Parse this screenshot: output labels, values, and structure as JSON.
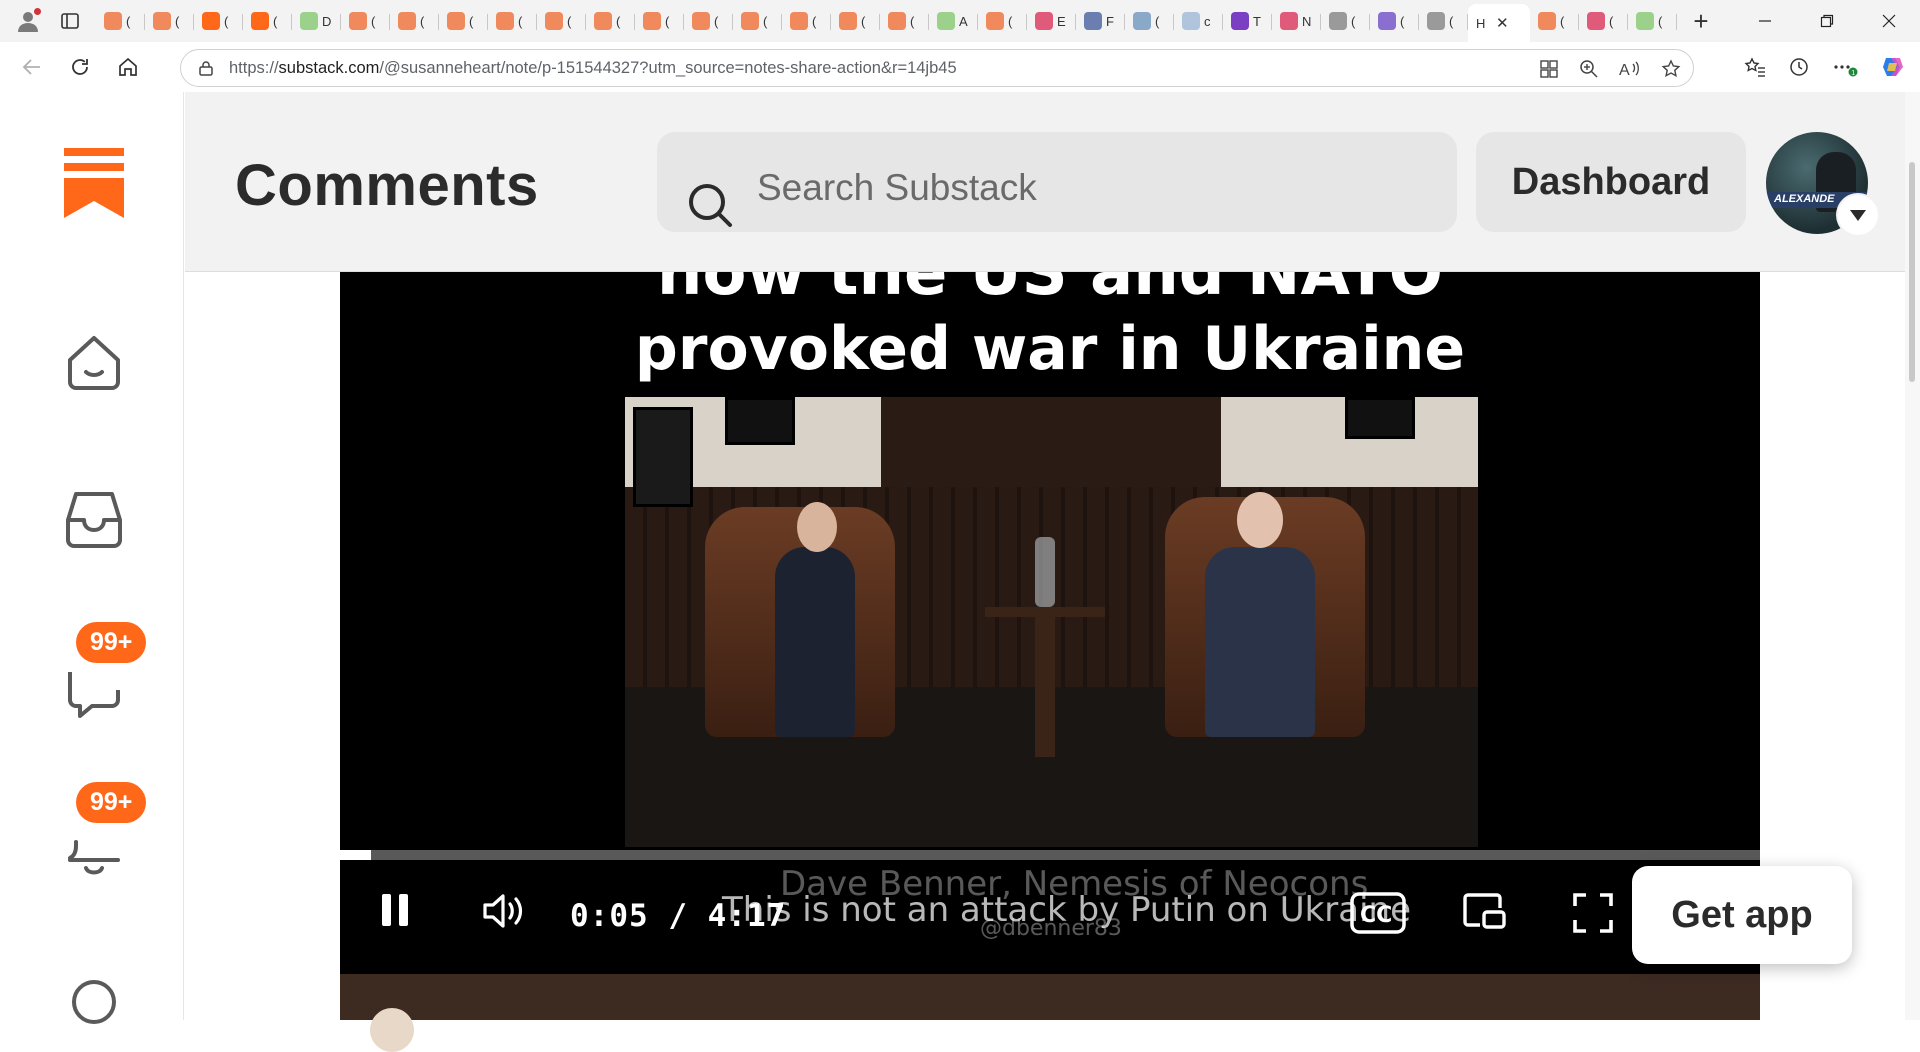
{
  "browser": {
    "tabs": [
      {
        "title": "(",
        "color": "#f08a5d"
      },
      {
        "title": "(",
        "color": "#f08a5d"
      },
      {
        "title": "(",
        "color": "#ff6719"
      },
      {
        "title": "(",
        "color": "#ff6719"
      },
      {
        "title": "D",
        "color": "#9bd18b"
      },
      {
        "title": "(",
        "color": "#f08a5d"
      },
      {
        "title": "(",
        "color": "#f08a5d"
      },
      {
        "title": "(",
        "color": "#f08a5d"
      },
      {
        "title": "(",
        "color": "#f08a5d"
      },
      {
        "title": "(",
        "color": "#f08a5d"
      },
      {
        "title": "(",
        "color": "#f08a5d"
      },
      {
        "title": "(",
        "color": "#f08a5d"
      },
      {
        "title": "(",
        "color": "#f08a5d"
      },
      {
        "title": "(",
        "color": "#f08a5d"
      },
      {
        "title": "(",
        "color": "#f08a5d"
      },
      {
        "title": "(",
        "color": "#f08a5d"
      },
      {
        "title": "(",
        "color": "#f08a5d"
      },
      {
        "title": "A",
        "color": "#9bd18b"
      },
      {
        "title": "(",
        "color": "#f08a5d"
      },
      {
        "title": "E",
        "color": "#e05a7a"
      },
      {
        "title": "F",
        "color": "#6a7fb0"
      },
      {
        "title": "(",
        "color": "#8aa8c8"
      },
      {
        "title": "c",
        "color": "#b0c4de"
      },
      {
        "title": "T",
        "color": "#7b3fc4"
      },
      {
        "title": "N",
        "color": "#e05a7a"
      },
      {
        "title": "(",
        "color": "#9a9a9a"
      },
      {
        "title": "(",
        "color": "#8a6fd0"
      },
      {
        "title": "(",
        "color": "#9a9a9a"
      }
    ],
    "active_tab": {
      "title": "H",
      "close": "✕"
    },
    "trailing_tabs": [
      {
        "title": "(",
        "color": "#f08a5d"
      },
      {
        "title": "(",
        "color": "#e05a7a"
      },
      {
        "title": "(",
        "color": "#9bd18b"
      }
    ],
    "new_tab": "+",
    "url_prefix": "https://",
    "url_domain": "substack.com",
    "url_rest": "/@susanneheart/note/p-151544327?utm_source=notes-share-action&r=14jb45"
  },
  "rail": {
    "badges": {
      "chat": "99+",
      "notifications": "99+"
    }
  },
  "header": {
    "title": "Comments",
    "search_placeholder": "Search Substack",
    "dashboard_label": "Dashboard",
    "avatar_text": "ALEXANDE"
  },
  "video": {
    "overlay_top": "how the US and NATO",
    "caption": "provoked war in Ukraine",
    "progress": 0.022,
    "time_current": "0:05",
    "time_separator": "/",
    "time_total": "4:17",
    "subtitle": "This is not an attack by Putin on Ukraine",
    "subtitle_ghost": "Dave Benner, Nemesis of Neocons",
    "watermark": "@dbenner83",
    "cc_label": "CC"
  },
  "get_app_label": "Get app",
  "colors": {
    "accent": "#ff6719",
    "header_bg": "#f2f2f2",
    "video_bg": "#000000"
  }
}
